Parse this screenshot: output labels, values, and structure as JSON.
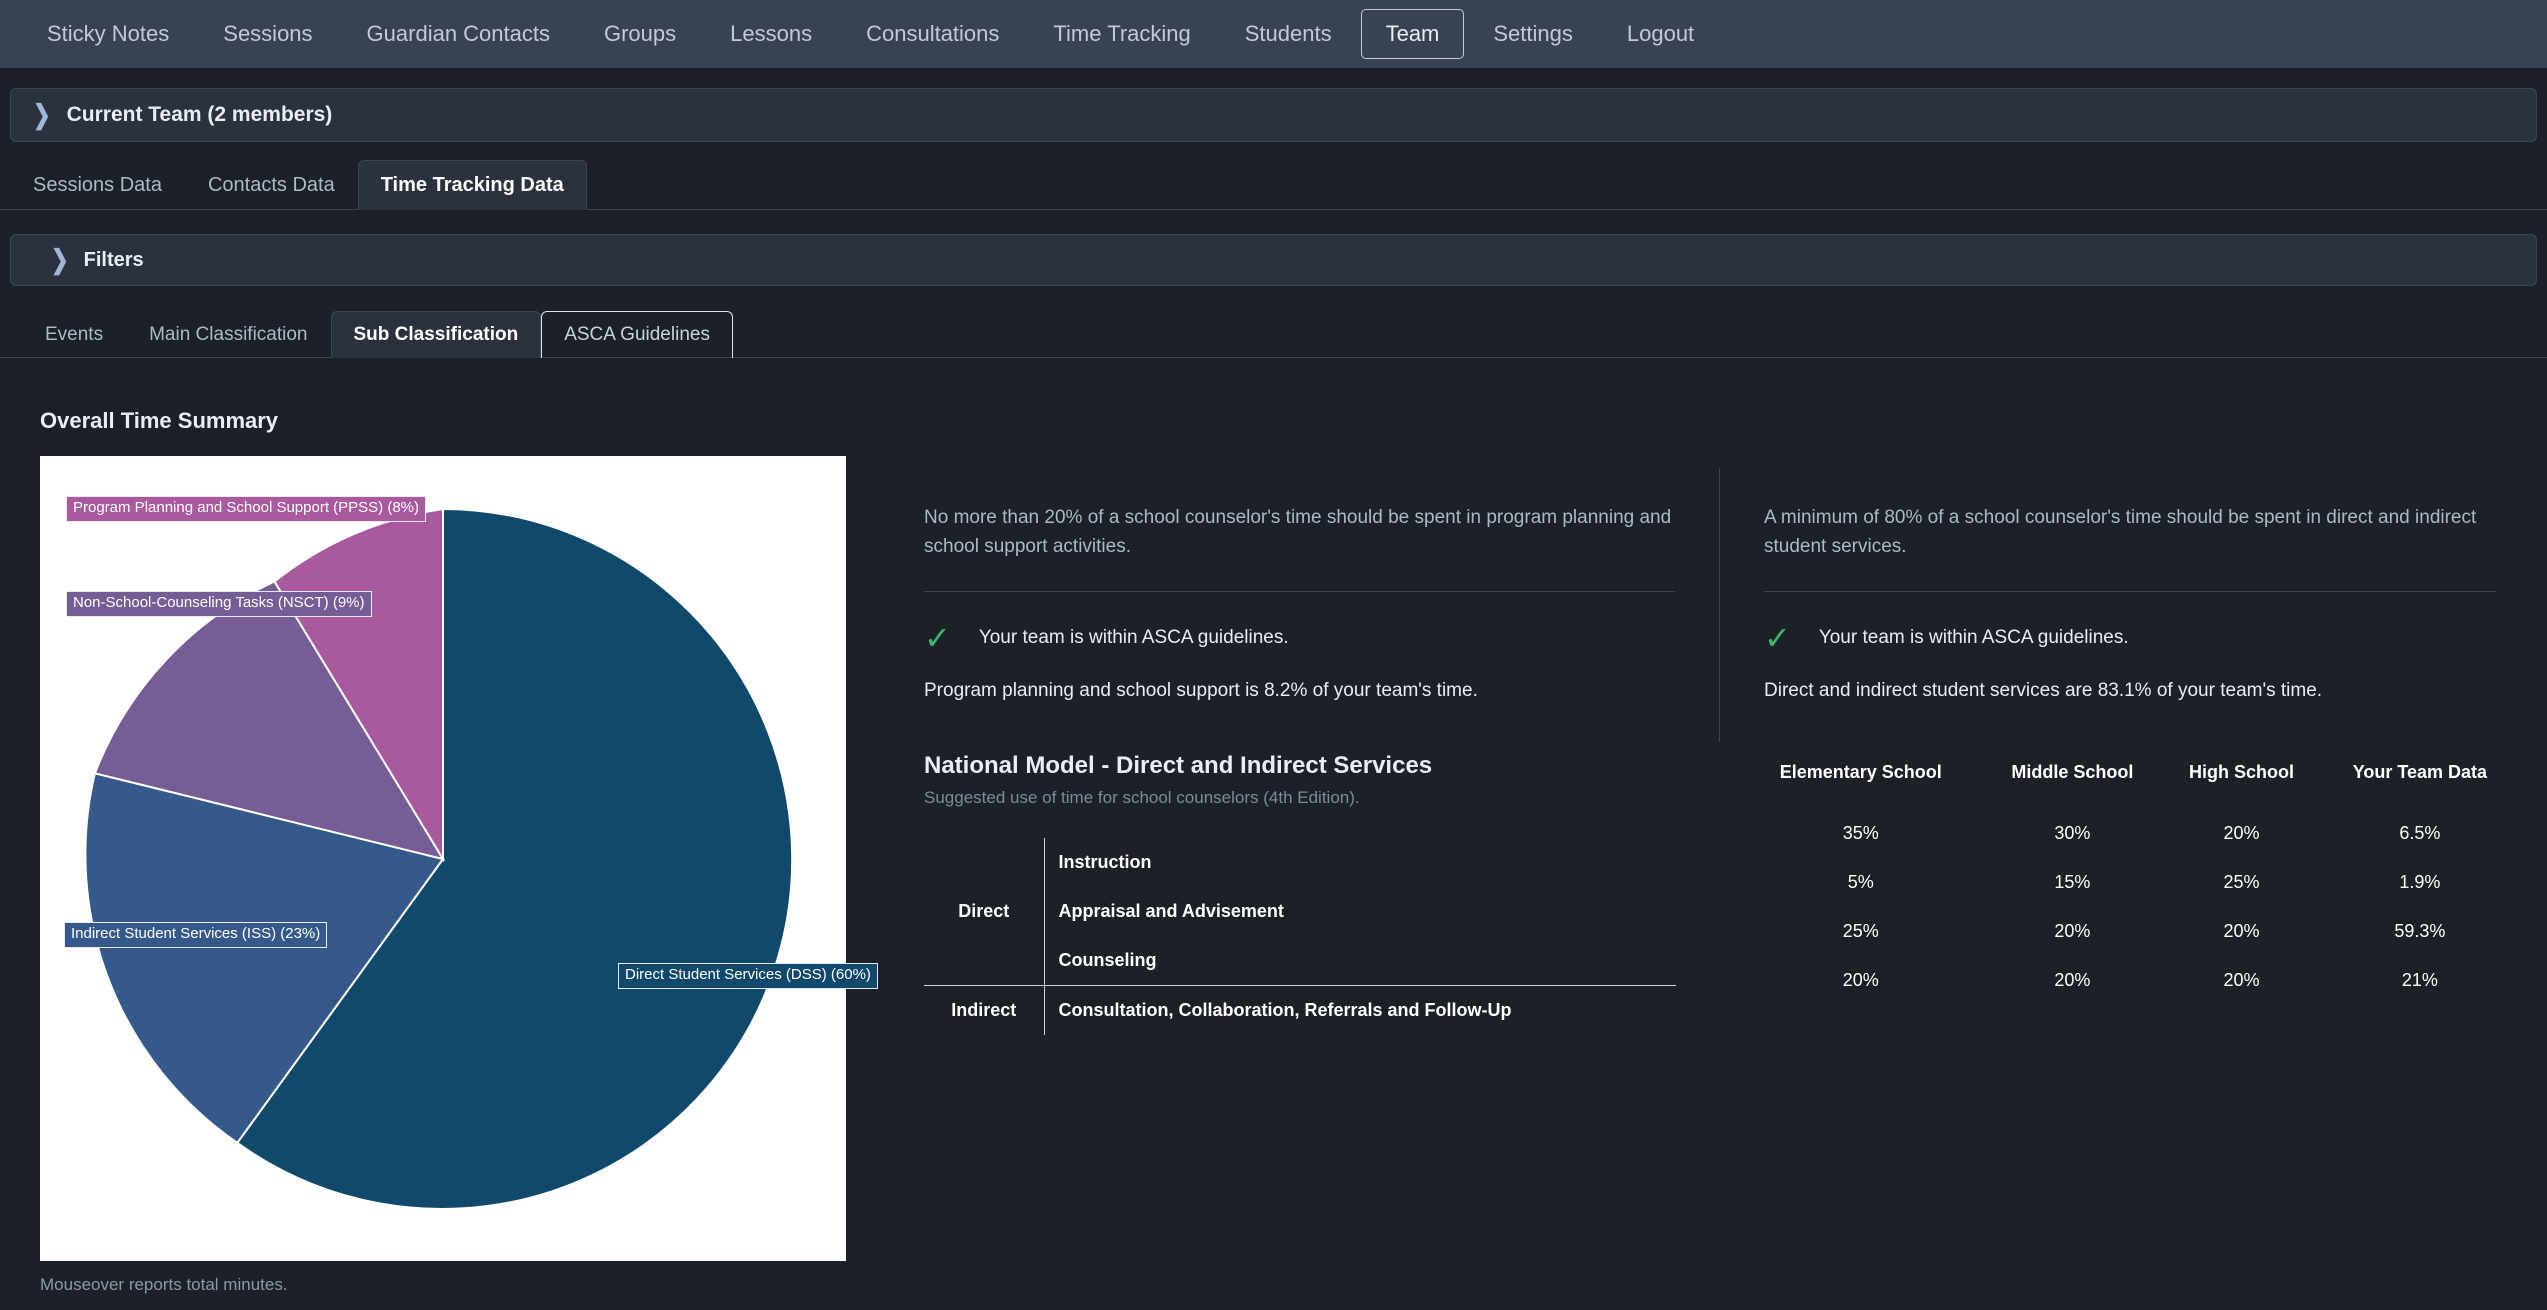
{
  "topnav": {
    "items": [
      {
        "label": "Sticky Notes",
        "active": false
      },
      {
        "label": "Sessions",
        "active": false
      },
      {
        "label": "Guardian Contacts",
        "active": false
      },
      {
        "label": "Groups",
        "active": false
      },
      {
        "label": "Lessons",
        "active": false
      },
      {
        "label": "Consultations",
        "active": false
      },
      {
        "label": "Time Tracking",
        "active": false
      },
      {
        "label": "Students",
        "active": false
      },
      {
        "label": "Team",
        "active": true
      },
      {
        "label": "Settings",
        "active": false
      },
      {
        "label": "Logout",
        "active": false
      }
    ]
  },
  "team_accordion": {
    "label": "Current Team (2 members)",
    "chevron": "chevron-right-icon"
  },
  "primary_tabs": [
    {
      "label": "Sessions Data",
      "active": false
    },
    {
      "label": "Contacts Data",
      "active": false
    },
    {
      "label": "Time Tracking Data",
      "active": true
    }
  ],
  "filters": {
    "label": "Filters",
    "chevron": "chevron-right-icon"
  },
  "secondary_tabs": [
    {
      "label": "Events",
      "state": "normal"
    },
    {
      "label": "Main Classification",
      "state": "normal"
    },
    {
      "label": "Sub Classification",
      "state": "active"
    },
    {
      "label": "ASCA Guidelines",
      "state": "focused"
    }
  ],
  "summary": {
    "title": "Overall Time Summary",
    "footnote": "Mouseover reports total minutes."
  },
  "chart_data": {
    "type": "pie",
    "title": "Overall Time Summary",
    "categories": [
      "Direct Student Services (DSS)",
      "Indirect Student Services (ISS)",
      "Non-School-Counseling Tasks (NSCT)",
      "Program Planning and School Support (PPSS)"
    ],
    "values": [
      60,
      23,
      9,
      8
    ],
    "labels": [
      "Direct Student Services (DSS) (60%)",
      "Indirect Student Services (ISS) (23%)",
      "Non-School-Counseling Tasks (NSCT) (9%)",
      "Program Planning and School Support (PPSS) (8%)"
    ],
    "colors": [
      "#10496b",
      "#35598a",
      "#765d96",
      "#a9599e"
    ],
    "legend": "labels-on-slices",
    "background": "#ffffff"
  },
  "panel_ppss": {
    "intro": "No more than 20% of a school counselor's time should be spent in program planning and school support activities.",
    "status_icon": "check-icon",
    "status_text": "Your team is within ASCA guidelines.",
    "stat": "Program planning and school support is 8.2% of your team's time.",
    "status_color": "#3fb56a"
  },
  "panel_services": {
    "intro": "A minimum of 80% of a school counselor's time should be spent in direct and indirect student services.",
    "status_icon": "check-icon",
    "status_text": "Your team is within ASCA guidelines.",
    "stat": "Direct and indirect student services are 83.1% of your team's time.",
    "status_color": "#3fb56a"
  },
  "national_model": {
    "title": "National Model - Direct and Indirect Services",
    "subtitle": "Suggested use of time for school counselors (4th Edition).",
    "rows": [
      {
        "category": "",
        "service": "Instruction"
      },
      {
        "category": "Direct",
        "service": "Appraisal and Advisement"
      },
      {
        "category": "",
        "service": "Counseling"
      },
      {
        "category": "Indirect",
        "service": "Consultation, Collaboration, Referrals and Follow-Up"
      }
    ]
  },
  "data_table": {
    "headers": [
      "Elementary School",
      "Middle School",
      "High School",
      "Your Team Data"
    ],
    "rows": [
      [
        "35%",
        "30%",
        "20%",
        "6.5%"
      ],
      [
        "5%",
        "15%",
        "25%",
        "1.9%"
      ],
      [
        "25%",
        "20%",
        "20%",
        "59.3%"
      ],
      [
        "20%",
        "20%",
        "20%",
        "21%"
      ]
    ]
  }
}
